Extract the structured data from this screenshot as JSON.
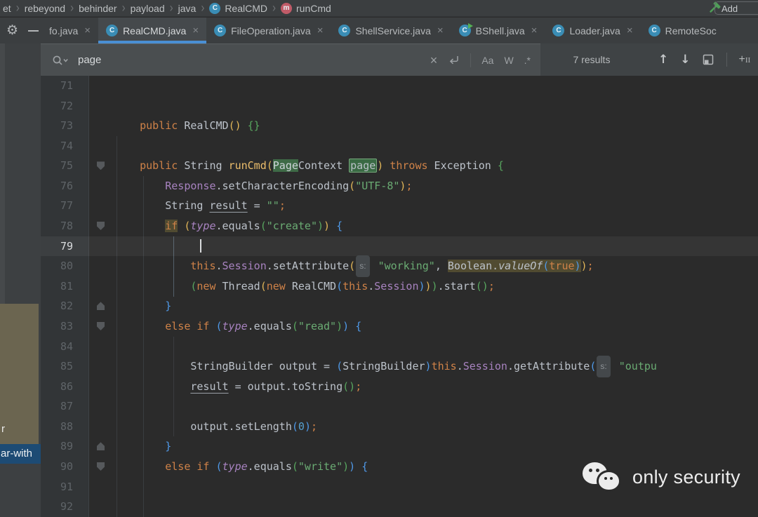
{
  "top_bar": {
    "breadcrumbs": [
      {
        "label": "et",
        "icon": null
      },
      {
        "label": "rebeyond",
        "icon": null
      },
      {
        "label": "behinder",
        "icon": null
      },
      {
        "label": "payload",
        "icon": null
      },
      {
        "label": "java",
        "icon": null
      },
      {
        "label": "RealCMD",
        "icon": "class"
      },
      {
        "label": "runCmd",
        "icon": "method"
      }
    ],
    "build_icon": "hammer-icon",
    "add_button_label": "Add"
  },
  "tab_bar": {
    "left_icons": [
      "settings-gear-icon",
      "hide-tabs-icon"
    ],
    "tabs": [
      {
        "label": "fo.java",
        "icon": null,
        "active": false,
        "partial": true,
        "closable": true
      },
      {
        "label": "RealCMD.java",
        "icon": "class",
        "active": true,
        "closable": true
      },
      {
        "label": "FileOperation.java",
        "icon": "class",
        "active": false,
        "closable": true
      },
      {
        "label": "ShellService.java",
        "icon": "class",
        "active": false,
        "closable": true
      },
      {
        "label": "BShell.java",
        "icon": "class-run",
        "active": false,
        "closable": true
      },
      {
        "label": "Loader.java",
        "icon": "class",
        "active": false,
        "closable": true
      },
      {
        "label": "RemoteSoc",
        "icon": "class",
        "active": false,
        "closable": false
      }
    ]
  },
  "search": {
    "query": "page",
    "results_text": "7 results",
    "toggles": {
      "match_case": "Aa",
      "words": "W",
      "regex": ".*"
    },
    "icons": [
      "search-icon",
      "clear-icon",
      "newline-icon",
      "previous-occurrence-icon",
      "next-occurrence-icon",
      "open-in-find-window-icon",
      "add-occurrence-icon",
      "remove-occurrence-icon"
    ]
  },
  "side_panel": {
    "item_partial": "r",
    "selected_item": "ar-with",
    "selection_color": "#1d4b74",
    "panel_color": "#6b6550"
  },
  "editor": {
    "current_line": 79,
    "lines": [
      {
        "n": 71,
        "t": []
      },
      {
        "n": 72,
        "t": []
      },
      {
        "n": 73,
        "t": [
          [
            "pl",
            "    "
          ],
          [
            "kw",
            "public"
          ],
          [
            "pl",
            " RealCMD"
          ],
          [
            "p1",
            "()"
          ],
          [
            "pl",
            " "
          ],
          [
            "p2",
            "{}"
          ]
        ]
      },
      {
        "n": 74,
        "t": []
      },
      {
        "n": 75,
        "fold": "open",
        "t": [
          [
            "pl",
            "    "
          ],
          [
            "kw",
            "public"
          ],
          [
            "pl",
            " String "
          ],
          [
            "decl",
            "runCmd"
          ],
          [
            "p1",
            "("
          ],
          [
            "mh",
            "Page"
          ],
          [
            "pl",
            "Context "
          ],
          [
            "mhc",
            "page"
          ],
          [
            "p1",
            ")"
          ],
          [
            "pl",
            " "
          ],
          [
            "kw",
            "throws"
          ],
          [
            "pl",
            " Exception "
          ],
          [
            "p2",
            "{"
          ]
        ]
      },
      {
        "n": 76,
        "t": [
          [
            "pl",
            "        "
          ],
          [
            "fld",
            "Response"
          ],
          [
            "pl",
            ".setCharacterEncoding"
          ],
          [
            "p1",
            "("
          ],
          [
            "str",
            "\"UTF-8\""
          ],
          [
            "p1",
            ")"
          ],
          [
            "semi",
            ";"
          ]
        ]
      },
      {
        "n": 77,
        "t": [
          [
            "pl",
            "        "
          ],
          [
            "pl",
            "String "
          ],
          [
            "ul",
            "result"
          ],
          [
            "pl",
            " = "
          ],
          [
            "str",
            "\"\""
          ],
          [
            "semi",
            ";"
          ]
        ]
      },
      {
        "n": 78,
        "fold": "open",
        "t": [
          [
            "pl",
            "        "
          ],
          [
            "kw olv",
            "if"
          ],
          [
            "pl",
            " "
          ],
          [
            "p1",
            "("
          ],
          [
            "tv",
            "type"
          ],
          [
            "pl",
            ".equals"
          ],
          [
            "p2",
            "("
          ],
          [
            "str",
            "\"create\""
          ],
          [
            "p2",
            ")"
          ],
          [
            "p1",
            ")"
          ],
          [
            "pl",
            " "
          ],
          [
            "p3",
            "{"
          ]
        ]
      },
      {
        "n": 79,
        "cur": true,
        "t": [
          [
            "pl",
            "            "
          ],
          [
            "caret",
            ""
          ]
        ]
      },
      {
        "n": 80,
        "t": [
          [
            "pl",
            "            "
          ],
          [
            "kw",
            "this"
          ],
          [
            "pl",
            "."
          ],
          [
            "fld",
            "Session"
          ],
          [
            "pl",
            ".setAttribute"
          ],
          [
            "p1",
            "("
          ],
          [
            "hint",
            "s:"
          ],
          [
            "pl",
            " "
          ],
          [
            "str",
            "\"working\""
          ],
          [
            "pl",
            ", "
          ],
          [
            "pl olv",
            "Boolean."
          ],
          [
            "it olv",
            "valueOf"
          ],
          [
            "p3 olv",
            "("
          ],
          [
            "kw olv",
            "true"
          ],
          [
            "p3 olv",
            ")"
          ],
          [
            "p1",
            ")"
          ],
          [
            "semi",
            ";"
          ]
        ]
      },
      {
        "n": 81,
        "t": [
          [
            "pl",
            "            "
          ],
          [
            "p2",
            "("
          ],
          [
            "kw",
            "new"
          ],
          [
            "pl",
            " Thread"
          ],
          [
            "p1",
            "("
          ],
          [
            "kw",
            "new"
          ],
          [
            "pl",
            " RealCMD"
          ],
          [
            "p3",
            "("
          ],
          [
            "kw",
            "this"
          ],
          [
            "pl",
            "."
          ],
          [
            "fld",
            "Session"
          ],
          [
            "p3",
            ")"
          ],
          [
            "p1",
            ")"
          ],
          [
            "p2",
            ")"
          ],
          [
            "pl",
            ".start"
          ],
          [
            "p2",
            "()"
          ],
          [
            "semi",
            ";"
          ]
        ]
      },
      {
        "n": 82,
        "fold": "close",
        "t": [
          [
            "pl",
            "        "
          ],
          [
            "p3",
            "}"
          ]
        ]
      },
      {
        "n": 83,
        "fold": "open",
        "t": [
          [
            "pl",
            "        "
          ],
          [
            "kw",
            "else"
          ],
          [
            "pl",
            " "
          ],
          [
            "kw",
            "if"
          ],
          [
            "pl",
            " "
          ],
          [
            "p3",
            "("
          ],
          [
            "tv",
            "type"
          ],
          [
            "pl",
            ".equals"
          ],
          [
            "p2",
            "("
          ],
          [
            "str",
            "\"read\""
          ],
          [
            "p2",
            ")"
          ],
          [
            "p3",
            ")"
          ],
          [
            "pl",
            " "
          ],
          [
            "p3",
            "{"
          ]
        ]
      },
      {
        "n": 84,
        "t": []
      },
      {
        "n": 85,
        "t": [
          [
            "pl",
            "            "
          ],
          [
            "pl",
            "StringBuilder output = "
          ],
          [
            "p3",
            "("
          ],
          [
            "pl",
            "StringBuilder"
          ],
          [
            "p3",
            ")"
          ],
          [
            "kw",
            "this"
          ],
          [
            "pl",
            "."
          ],
          [
            "fld",
            "Session"
          ],
          [
            "pl",
            ".getAttribute"
          ],
          [
            "p3",
            "("
          ],
          [
            "hint",
            "s:"
          ],
          [
            "pl",
            " "
          ],
          [
            "str",
            "\"outpu"
          ]
        ]
      },
      {
        "n": 86,
        "t": [
          [
            "pl",
            "            "
          ],
          [
            "ul",
            "result"
          ],
          [
            "pl",
            " = output.toString"
          ],
          [
            "p2",
            "()"
          ],
          [
            "semi",
            ";"
          ]
        ]
      },
      {
        "n": 87,
        "t": []
      },
      {
        "n": 88,
        "t": [
          [
            "pl",
            "            "
          ],
          [
            "pl",
            "output.setLength"
          ],
          [
            "p3",
            "("
          ],
          [
            "num",
            "0"
          ],
          [
            "p3",
            ")"
          ],
          [
            "semi",
            ";"
          ]
        ]
      },
      {
        "n": 89,
        "fold": "close",
        "t": [
          [
            "pl",
            "        "
          ],
          [
            "p3",
            "}"
          ]
        ]
      },
      {
        "n": 90,
        "fold": "open",
        "t": [
          [
            "pl",
            "        "
          ],
          [
            "kw",
            "else"
          ],
          [
            "pl",
            " "
          ],
          [
            "kw",
            "if"
          ],
          [
            "pl",
            " "
          ],
          [
            "p3",
            "("
          ],
          [
            "tv",
            "type"
          ],
          [
            "pl",
            ".equals"
          ],
          [
            "p2",
            "("
          ],
          [
            "str",
            "\"write\""
          ],
          [
            "p2",
            ")"
          ],
          [
            "p3",
            ")"
          ],
          [
            "pl",
            " "
          ],
          [
            "p3",
            "{"
          ]
        ]
      },
      {
        "n": 91,
        "t": []
      },
      {
        "n": 92,
        "t": []
      }
    ]
  },
  "watermark": {
    "text": "only security"
  },
  "colors": {
    "editor_bg": "#2b2b2b",
    "bar_bg": "#3b3e40",
    "active_tab_underline": "#4a8fd4",
    "search_field_bg": "#4a4e50",
    "keyword": "#cf8248",
    "string": "#6aab73",
    "field": "#a883c0",
    "match_highlight": "#3e6a46",
    "usage_highlight": "#514b31",
    "class_icon": "#3a8db5",
    "method_icon": "#c05b68",
    "hammer": "#4f9e58"
  }
}
